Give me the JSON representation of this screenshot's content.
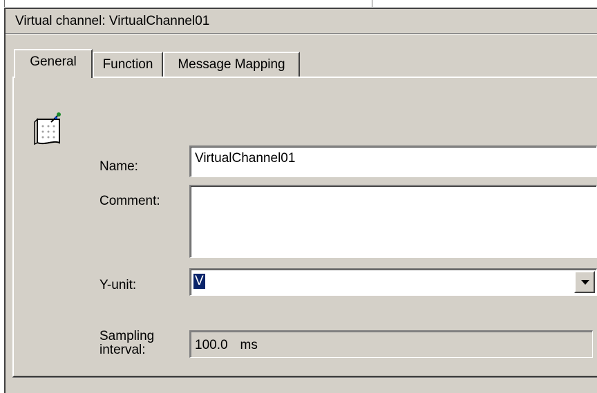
{
  "window": {
    "title": "Virtual channel: VirtualChannel01"
  },
  "tabs": [
    {
      "label": "General",
      "active": true
    },
    {
      "label": "Function",
      "active": false
    },
    {
      "label": "Message Mapping",
      "active": false
    }
  ],
  "form": {
    "icon": "channel-document-icon",
    "name_label": "Name:",
    "name_value": "VirtualChannel01",
    "comment_label": "Comment:",
    "comment_value": "",
    "yunit_label": "Y-unit:",
    "yunit_value": "V",
    "sampling_label_line1": "Sampling",
    "sampling_label_line2": "interval:",
    "sampling_value": "100.0",
    "sampling_unit": "ms"
  },
  "colors": {
    "dialog_face": "#d4d0c8",
    "selection": "#0a246a"
  }
}
